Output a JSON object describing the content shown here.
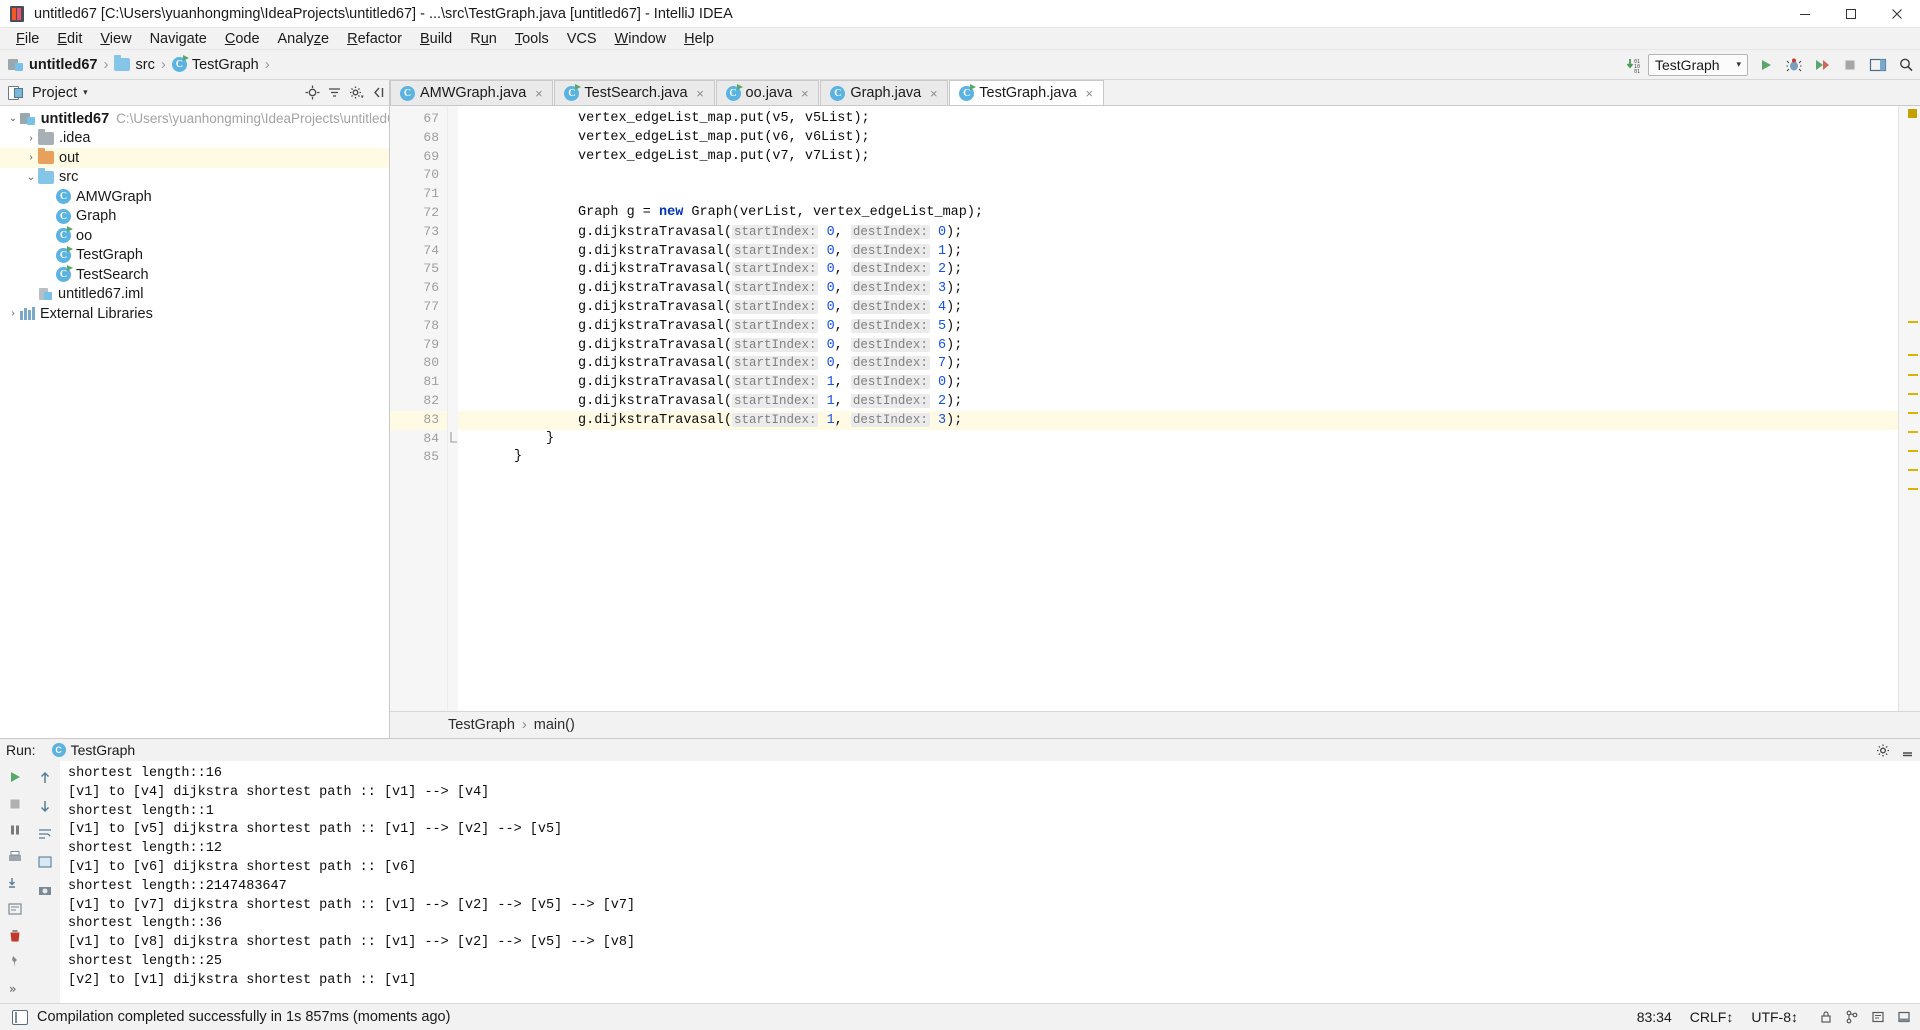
{
  "window": {
    "title": "untitled67 [C:\\Users\\yuanhongming\\IdeaProjects\\untitled67] - ...\\src\\TestGraph.java [untitled67] - IntelliJ IDEA",
    "minimize_label": "Minimize",
    "maximize_label": "Maximize",
    "close_label": "Close"
  },
  "menu": {
    "items": [
      "File",
      "Edit",
      "View",
      "Navigate",
      "Code",
      "Analyze",
      "Refactor",
      "Build",
      "Run",
      "Tools",
      "VCS",
      "Window",
      "Help"
    ]
  },
  "navbar": {
    "breadcrumbs": [
      {
        "label": "untitled67",
        "icon": "module-icon",
        "bold": true
      },
      {
        "label": "src",
        "icon": "folder-icon",
        "bold": false
      },
      {
        "label": "TestGraph",
        "icon": "class-icon",
        "bold": false
      }
    ],
    "separator": "›",
    "run_config": "TestGraph",
    "run_config_caret": "▾",
    "buttons": [
      "run-button",
      "debug-button",
      "coverage-button",
      "stop-button",
      "layout-button",
      "search-button"
    ]
  },
  "project_panel": {
    "title": "Project",
    "caret": "▾",
    "tools": [
      "locate-icon",
      "collapse-all-icon",
      "settings-icon",
      "hide-icon"
    ],
    "tree": [
      {
        "depth": 0,
        "arrow": "⌄",
        "icon": "module-icon",
        "label": "untitled67",
        "bold": true,
        "path": "C:\\Users\\yuanhongming\\IdeaProjects\\untitled6",
        "highlight": false
      },
      {
        "depth": 1,
        "arrow": "›",
        "icon": "folder-grey-icon",
        "label": ".idea",
        "bold": false,
        "path": "",
        "highlight": false
      },
      {
        "depth": 1,
        "arrow": "›",
        "icon": "folder-orange-icon",
        "label": "out",
        "bold": false,
        "path": "",
        "highlight": true
      },
      {
        "depth": 1,
        "arrow": "⌄",
        "icon": "folder-blue-icon",
        "label": "src",
        "bold": false,
        "path": "",
        "highlight": false
      },
      {
        "depth": 2,
        "arrow": "",
        "icon": "class-icon",
        "label": "AMWGraph",
        "bold": false,
        "path": "",
        "highlight": false
      },
      {
        "depth": 2,
        "arrow": "",
        "icon": "class-icon",
        "label": "Graph",
        "bold": false,
        "path": "",
        "highlight": false
      },
      {
        "depth": 2,
        "arrow": "",
        "icon": "class-runnable-icon",
        "label": "oo",
        "bold": false,
        "path": "",
        "highlight": false
      },
      {
        "depth": 2,
        "arrow": "",
        "icon": "class-runnable-icon",
        "label": "TestGraph",
        "bold": false,
        "path": "",
        "highlight": false
      },
      {
        "depth": 2,
        "arrow": "",
        "icon": "class-runnable-icon",
        "label": "TestSearch",
        "bold": false,
        "path": "",
        "highlight": false
      },
      {
        "depth": 1,
        "arrow": "",
        "icon": "iml-icon",
        "label": "untitled67.iml",
        "bold": false,
        "path": "",
        "highlight": false
      },
      {
        "depth": 0,
        "arrow": "›",
        "icon": "library-icon",
        "label": "External Libraries",
        "bold": false,
        "path": "",
        "highlight": false
      }
    ]
  },
  "editor": {
    "tabs": [
      {
        "label": "AMWGraph.java",
        "active": false,
        "icon": "class-icon",
        "close": "×"
      },
      {
        "label": "TestSearch.java",
        "active": false,
        "icon": "class-runnable-icon",
        "close": "×"
      },
      {
        "label": "oo.java",
        "active": false,
        "icon": "class-runnable-icon",
        "close": "×"
      },
      {
        "label": "Graph.java",
        "active": false,
        "icon": "class-icon",
        "close": "×"
      },
      {
        "label": "TestGraph.java",
        "active": true,
        "icon": "class-runnable-icon",
        "close": "×"
      }
    ],
    "first_line_number": 67,
    "highlight_line": 83,
    "lines": [
      {
        "n": 67,
        "indent": 8,
        "segments": [
          {
            "t": "vertex_edgeList_map.put(v5, v5List);",
            "c": "plain"
          }
        ]
      },
      {
        "n": 68,
        "indent": 8,
        "segments": [
          {
            "t": "vertex_edgeList_map.put(v6, v6List);",
            "c": "plain"
          }
        ]
      },
      {
        "n": 69,
        "indent": 8,
        "segments": [
          {
            "t": "vertex_edgeList_map.put(v7, v7List);",
            "c": "plain"
          }
        ]
      },
      {
        "n": 70,
        "indent": 0,
        "segments": []
      },
      {
        "n": 71,
        "indent": 0,
        "segments": []
      },
      {
        "n": 72,
        "indent": 8,
        "segments": [
          {
            "t": "Graph g = ",
            "c": "plain"
          },
          {
            "t": "new",
            "c": "kw"
          },
          {
            "t": " Graph(verList, vertex_edgeList_map);",
            "c": "plain"
          }
        ]
      },
      {
        "n": 73,
        "indent": 8,
        "segments": [
          {
            "t": "g.dijkstraTravasal(",
            "c": "plain"
          },
          {
            "t": "startIndex:",
            "c": "hint"
          },
          {
            "t": " ",
            "c": "plain"
          },
          {
            "t": "0",
            "c": "num"
          },
          {
            "t": ", ",
            "c": "plain"
          },
          {
            "t": "destIndex:",
            "c": "hint"
          },
          {
            "t": " ",
            "c": "plain"
          },
          {
            "t": "0",
            "c": "num"
          },
          {
            "t": ");",
            "c": "plain"
          }
        ]
      },
      {
        "n": 74,
        "indent": 8,
        "segments": [
          {
            "t": "g.dijkstraTravasal(",
            "c": "plain"
          },
          {
            "t": "startIndex:",
            "c": "hint"
          },
          {
            "t": " ",
            "c": "plain"
          },
          {
            "t": "0",
            "c": "num"
          },
          {
            "t": ", ",
            "c": "plain"
          },
          {
            "t": "destIndex:",
            "c": "hint"
          },
          {
            "t": " ",
            "c": "plain"
          },
          {
            "t": "1",
            "c": "num"
          },
          {
            "t": ");",
            "c": "plain"
          }
        ]
      },
      {
        "n": 75,
        "indent": 8,
        "segments": [
          {
            "t": "g.dijkstraTravasal(",
            "c": "plain"
          },
          {
            "t": "startIndex:",
            "c": "hint"
          },
          {
            "t": " ",
            "c": "plain"
          },
          {
            "t": "0",
            "c": "num"
          },
          {
            "t": ", ",
            "c": "plain"
          },
          {
            "t": "destIndex:",
            "c": "hint"
          },
          {
            "t": " ",
            "c": "plain"
          },
          {
            "t": "2",
            "c": "num"
          },
          {
            "t": ");",
            "c": "plain"
          }
        ]
      },
      {
        "n": 76,
        "indent": 8,
        "segments": [
          {
            "t": "g.dijkstraTravasal(",
            "c": "plain"
          },
          {
            "t": "startIndex:",
            "c": "hint"
          },
          {
            "t": " ",
            "c": "plain"
          },
          {
            "t": "0",
            "c": "num"
          },
          {
            "t": ", ",
            "c": "plain"
          },
          {
            "t": "destIndex:",
            "c": "hint"
          },
          {
            "t": " ",
            "c": "plain"
          },
          {
            "t": "3",
            "c": "num"
          },
          {
            "t": ");",
            "c": "plain"
          }
        ]
      },
      {
        "n": 77,
        "indent": 8,
        "segments": [
          {
            "t": "g.dijkstraTravasal(",
            "c": "plain"
          },
          {
            "t": "startIndex:",
            "c": "hint"
          },
          {
            "t": " ",
            "c": "plain"
          },
          {
            "t": "0",
            "c": "num"
          },
          {
            "t": ", ",
            "c": "plain"
          },
          {
            "t": "destIndex:",
            "c": "hint"
          },
          {
            "t": " ",
            "c": "plain"
          },
          {
            "t": "4",
            "c": "num"
          },
          {
            "t": ");",
            "c": "plain"
          }
        ]
      },
      {
        "n": 78,
        "indent": 8,
        "segments": [
          {
            "t": "g.dijkstraTravasal(",
            "c": "plain"
          },
          {
            "t": "startIndex:",
            "c": "hint"
          },
          {
            "t": " ",
            "c": "plain"
          },
          {
            "t": "0",
            "c": "num"
          },
          {
            "t": ", ",
            "c": "plain"
          },
          {
            "t": "destIndex:",
            "c": "hint"
          },
          {
            "t": " ",
            "c": "plain"
          },
          {
            "t": "5",
            "c": "num"
          },
          {
            "t": ");",
            "c": "plain"
          }
        ]
      },
      {
        "n": 79,
        "indent": 8,
        "segments": [
          {
            "t": "g.dijkstraTravasal(",
            "c": "plain"
          },
          {
            "t": "startIndex:",
            "c": "hint"
          },
          {
            "t": " ",
            "c": "plain"
          },
          {
            "t": "0",
            "c": "num"
          },
          {
            "t": ", ",
            "c": "plain"
          },
          {
            "t": "destIndex:",
            "c": "hint"
          },
          {
            "t": " ",
            "c": "plain"
          },
          {
            "t": "6",
            "c": "num"
          },
          {
            "t": ");",
            "c": "plain"
          }
        ]
      },
      {
        "n": 80,
        "indent": 8,
        "segments": [
          {
            "t": "g.dijkstraTravasal(",
            "c": "plain"
          },
          {
            "t": "startIndex:",
            "c": "hint"
          },
          {
            "t": " ",
            "c": "plain"
          },
          {
            "t": "0",
            "c": "num"
          },
          {
            "t": ", ",
            "c": "plain"
          },
          {
            "t": "destIndex:",
            "c": "hint"
          },
          {
            "t": " ",
            "c": "plain"
          },
          {
            "t": "7",
            "c": "num"
          },
          {
            "t": ");",
            "c": "plain"
          }
        ]
      },
      {
        "n": 81,
        "indent": 8,
        "segments": [
          {
            "t": "g.dijkstraTravasal(",
            "c": "plain"
          },
          {
            "t": "startIndex:",
            "c": "hint"
          },
          {
            "t": " ",
            "c": "plain"
          },
          {
            "t": "1",
            "c": "num"
          },
          {
            "t": ", ",
            "c": "plain"
          },
          {
            "t": "destIndex:",
            "c": "hint"
          },
          {
            "t": " ",
            "c": "plain"
          },
          {
            "t": "0",
            "c": "num"
          },
          {
            "t": ");",
            "c": "plain"
          }
        ]
      },
      {
        "n": 82,
        "indent": 8,
        "segments": [
          {
            "t": "g.dijkstraTravasal(",
            "c": "plain"
          },
          {
            "t": "startIndex:",
            "c": "hint"
          },
          {
            "t": " ",
            "c": "plain"
          },
          {
            "t": "1",
            "c": "num"
          },
          {
            "t": ", ",
            "c": "plain"
          },
          {
            "t": "destIndex:",
            "c": "hint"
          },
          {
            "t": " ",
            "c": "plain"
          },
          {
            "t": "2",
            "c": "num"
          },
          {
            "t": ");",
            "c": "plain"
          }
        ]
      },
      {
        "n": 83,
        "indent": 8,
        "segments": [
          {
            "t": "g.dijkstraTravasal(",
            "c": "plain"
          },
          {
            "t": "startIndex:",
            "c": "hint"
          },
          {
            "t": " ",
            "c": "plain"
          },
          {
            "t": "1",
            "c": "num"
          },
          {
            "t": ", ",
            "c": "plain"
          },
          {
            "t": "destIndex:",
            "c": "hint"
          },
          {
            "t": " ",
            "c": "plain"
          },
          {
            "t": "3",
            "c": "num"
          },
          {
            "t": ");",
            "c": "plain"
          }
        ]
      },
      {
        "n": 84,
        "indent": 4,
        "segments": [
          {
            "t": "}",
            "c": "plain"
          }
        ]
      },
      {
        "n": 85,
        "indent": 0,
        "segments": [
          {
            "t": "}",
            "c": "plain"
          }
        ]
      }
    ],
    "breadcrumb": {
      "class": "TestGraph",
      "sep": "›",
      "method": "main()"
    }
  },
  "run_panel": {
    "title": "Run:",
    "tab_label": "TestGraph",
    "left_buttons": [
      "rerun-icon",
      "stop-icon",
      "pause-icon",
      "trash-icon"
    ],
    "right_buttons": [
      "settings-icon",
      "minimize-icon"
    ],
    "console_lines": [
      "shortest length::16",
      "[v1] to [v4] dijkstra shortest path :: [v1] --> [v4]",
      "shortest length::1",
      "[v1] to [v5] dijkstra shortest path :: [v1] --> [v2] --> [v5]",
      "shortest length::12",
      "[v1] to [v6] dijkstra shortest path :: [v6]",
      "shortest length::2147483647",
      "[v1] to [v7] dijkstra shortest path :: [v1] --> [v2] --> [v5] --> [v7]",
      "shortest length::36",
      "[v1] to [v8] dijkstra shortest path :: [v1] --> [v2] --> [v5] --> [v8]",
      "shortest length::25",
      "[v2] to [v1] dijkstra shortest path :: [v1]"
    ]
  },
  "statusbar": {
    "message": "Compilation completed successfully in 1s 857ms (moments ago)",
    "caret_position": "83:34",
    "line_separator": "CRLF↕",
    "encoding": "UTF-8↕",
    "icons": [
      "lock-icon",
      "branch-icon",
      "event-log-icon",
      "hide-icon"
    ]
  }
}
